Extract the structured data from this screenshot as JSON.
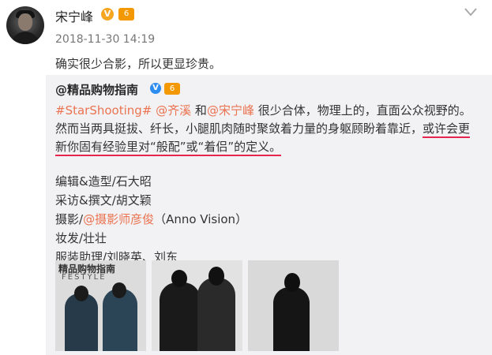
{
  "post": {
    "username": "宋宁峰",
    "v_badge": "V",
    "vip_badge": "6",
    "timestamp": "2018-11-30 14:19",
    "text": "确实很少合影，所以更显珍贵。"
  },
  "repost": {
    "author": "@精品购物指南",
    "v_badge": "V",
    "vip_badge": "6",
    "hashtag": "#StarShooting#",
    "mention1": "@齐溪",
    "and_text": " 和",
    "mention2": "@宋宁峰",
    "body_part1": " 很少合体，物理上的，直面公众视野的。然而当两具挺拔、纤长，小腿肌肉随时聚敛着力量的身躯顾盼着靠近，",
    "body_underlined": "或许会更新你固有经验里对“般配”或“着侣”的定义。",
    "credits": {
      "editor": "编辑&造型/石大昭",
      "writer": "采访&撰文/胡文颖",
      "photo_prefix": "摄影/",
      "photo_mention": "@摄影师彦俊",
      "photo_suffix": "（Anno Vision）",
      "hair": "妆发/壮壮",
      "wardrobe": "服装助理/刘晓英、刘东"
    },
    "thumbnail_title": "精品购物指南",
    "thumbnail_subtitle": "FESTYLE"
  },
  "colors": {
    "link": "#eb7350",
    "underline": "#e5264e",
    "repost_bg": "#f2f2f5"
  },
  "icons": [
    "chevron-down-icon"
  ]
}
